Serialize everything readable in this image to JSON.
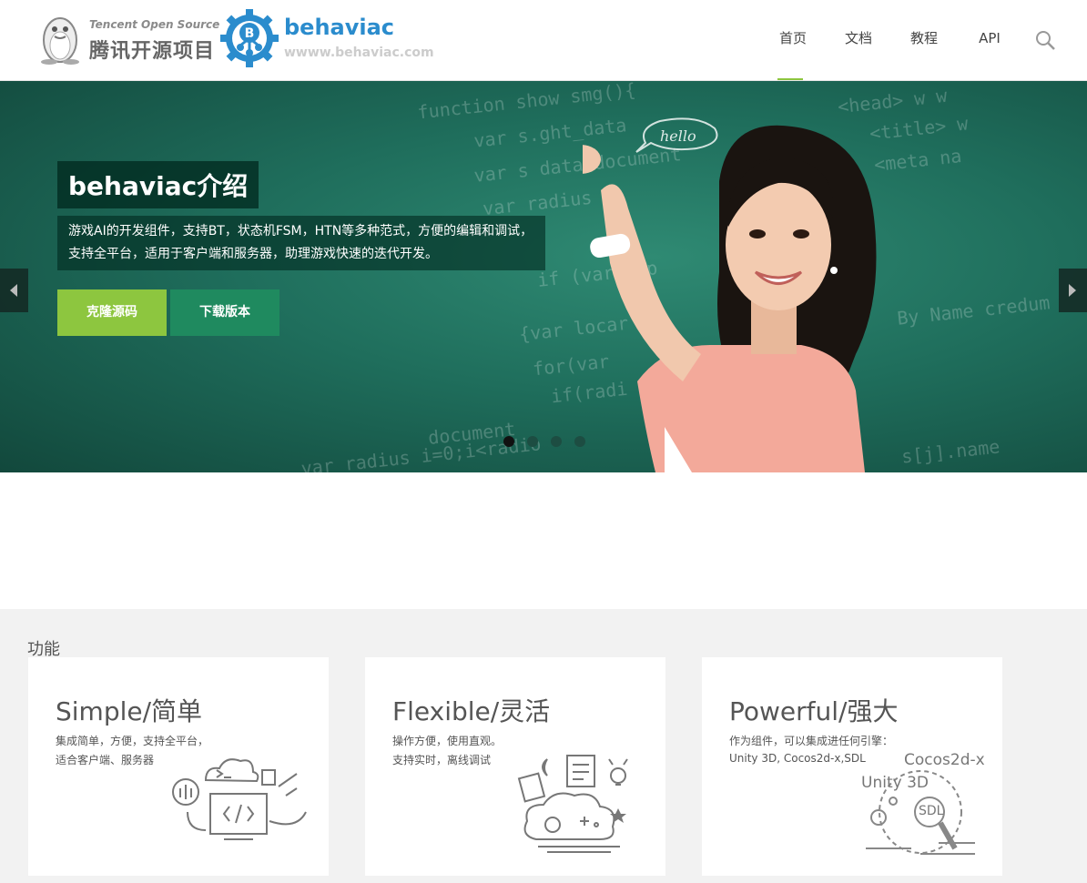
{
  "header": {
    "tencent_logo": {
      "en": "Tencent Open Source",
      "zh": "腾讯开源项目"
    },
    "brand": {
      "name": "behaviac",
      "url": "wwww.behaviac.com"
    },
    "nav": [
      {
        "label": "首页",
        "active": true
      },
      {
        "label": "文档",
        "active": false
      },
      {
        "label": "教程",
        "active": false
      },
      {
        "label": "API",
        "active": false
      }
    ],
    "search_icon": "search-icon"
  },
  "hero": {
    "title": "behaviac介绍",
    "desc_line1": "游戏AI的开发组件，支持BT，状态机FSM，HTN等多种范式，方便的编辑和调试，",
    "desc_line2": "支持全平台，适用于客户端和服务器，助理游戏快速的迭代开发。",
    "buttons": {
      "clone": "克隆源码",
      "download": "下载版本"
    },
    "carousel": {
      "slides": 4,
      "active": 1
    }
  },
  "features": {
    "label": "功能",
    "cards": [
      {
        "title": "Simple/简单",
        "line1": "集成简单，方便，支持全平台，",
        "line2": "适合客户端、服务器"
      },
      {
        "title": "Flexible/灵活",
        "line1": "操作方便，使用直观。",
        "line2": "支持实时，离线调试"
      },
      {
        "title": "Powerful/强大",
        "line1": "作为组件，可以集成进任何引擎：",
        "line2": "Unity 3D, Cocos2d-x,SDL",
        "illustration_labels": {
          "cocos": "Cocos2d-x",
          "unity": "Unity 3D",
          "sdl": "SDL"
        }
      }
    ]
  },
  "colors": {
    "accent_green": "#8dc63f",
    "dark_green": "#1f8a5f",
    "brand_blue": "#2b8ccd"
  }
}
